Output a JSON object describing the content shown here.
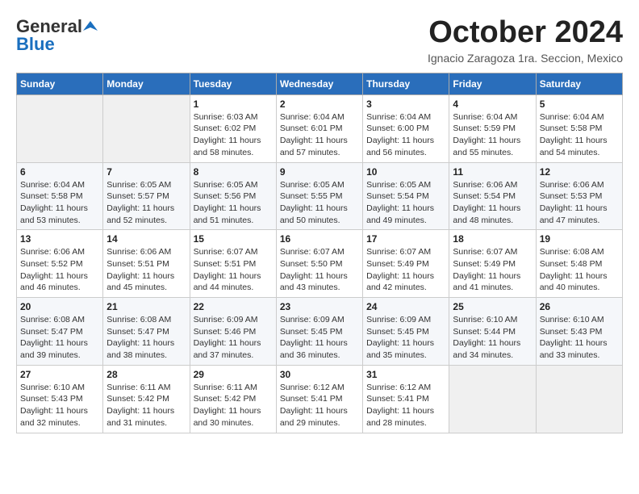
{
  "header": {
    "logo_general": "General",
    "logo_blue": "Blue",
    "month_title": "October 2024",
    "location": "Ignacio Zaragoza 1ra. Seccion, Mexico"
  },
  "days_of_week": [
    "Sunday",
    "Monday",
    "Tuesday",
    "Wednesday",
    "Thursday",
    "Friday",
    "Saturday"
  ],
  "weeks": [
    [
      {
        "day": "",
        "info": ""
      },
      {
        "day": "",
        "info": ""
      },
      {
        "day": "1",
        "info": "Sunrise: 6:03 AM\nSunset: 6:02 PM\nDaylight: 11 hours and 58 minutes."
      },
      {
        "day": "2",
        "info": "Sunrise: 6:04 AM\nSunset: 6:01 PM\nDaylight: 11 hours and 57 minutes."
      },
      {
        "day": "3",
        "info": "Sunrise: 6:04 AM\nSunset: 6:00 PM\nDaylight: 11 hours and 56 minutes."
      },
      {
        "day": "4",
        "info": "Sunrise: 6:04 AM\nSunset: 5:59 PM\nDaylight: 11 hours and 55 minutes."
      },
      {
        "day": "5",
        "info": "Sunrise: 6:04 AM\nSunset: 5:58 PM\nDaylight: 11 hours and 54 minutes."
      }
    ],
    [
      {
        "day": "6",
        "info": "Sunrise: 6:04 AM\nSunset: 5:58 PM\nDaylight: 11 hours and 53 minutes."
      },
      {
        "day": "7",
        "info": "Sunrise: 6:05 AM\nSunset: 5:57 PM\nDaylight: 11 hours and 52 minutes."
      },
      {
        "day": "8",
        "info": "Sunrise: 6:05 AM\nSunset: 5:56 PM\nDaylight: 11 hours and 51 minutes."
      },
      {
        "day": "9",
        "info": "Sunrise: 6:05 AM\nSunset: 5:55 PM\nDaylight: 11 hours and 50 minutes."
      },
      {
        "day": "10",
        "info": "Sunrise: 6:05 AM\nSunset: 5:54 PM\nDaylight: 11 hours and 49 minutes."
      },
      {
        "day": "11",
        "info": "Sunrise: 6:06 AM\nSunset: 5:54 PM\nDaylight: 11 hours and 48 minutes."
      },
      {
        "day": "12",
        "info": "Sunrise: 6:06 AM\nSunset: 5:53 PM\nDaylight: 11 hours and 47 minutes."
      }
    ],
    [
      {
        "day": "13",
        "info": "Sunrise: 6:06 AM\nSunset: 5:52 PM\nDaylight: 11 hours and 46 minutes."
      },
      {
        "day": "14",
        "info": "Sunrise: 6:06 AM\nSunset: 5:51 PM\nDaylight: 11 hours and 45 minutes."
      },
      {
        "day": "15",
        "info": "Sunrise: 6:07 AM\nSunset: 5:51 PM\nDaylight: 11 hours and 44 minutes."
      },
      {
        "day": "16",
        "info": "Sunrise: 6:07 AM\nSunset: 5:50 PM\nDaylight: 11 hours and 43 minutes."
      },
      {
        "day": "17",
        "info": "Sunrise: 6:07 AM\nSunset: 5:49 PM\nDaylight: 11 hours and 42 minutes."
      },
      {
        "day": "18",
        "info": "Sunrise: 6:07 AM\nSunset: 5:49 PM\nDaylight: 11 hours and 41 minutes."
      },
      {
        "day": "19",
        "info": "Sunrise: 6:08 AM\nSunset: 5:48 PM\nDaylight: 11 hours and 40 minutes."
      }
    ],
    [
      {
        "day": "20",
        "info": "Sunrise: 6:08 AM\nSunset: 5:47 PM\nDaylight: 11 hours and 39 minutes."
      },
      {
        "day": "21",
        "info": "Sunrise: 6:08 AM\nSunset: 5:47 PM\nDaylight: 11 hours and 38 minutes."
      },
      {
        "day": "22",
        "info": "Sunrise: 6:09 AM\nSunset: 5:46 PM\nDaylight: 11 hours and 37 minutes."
      },
      {
        "day": "23",
        "info": "Sunrise: 6:09 AM\nSunset: 5:45 PM\nDaylight: 11 hours and 36 minutes."
      },
      {
        "day": "24",
        "info": "Sunrise: 6:09 AM\nSunset: 5:45 PM\nDaylight: 11 hours and 35 minutes."
      },
      {
        "day": "25",
        "info": "Sunrise: 6:10 AM\nSunset: 5:44 PM\nDaylight: 11 hours and 34 minutes."
      },
      {
        "day": "26",
        "info": "Sunrise: 6:10 AM\nSunset: 5:43 PM\nDaylight: 11 hours and 33 minutes."
      }
    ],
    [
      {
        "day": "27",
        "info": "Sunrise: 6:10 AM\nSunset: 5:43 PM\nDaylight: 11 hours and 32 minutes."
      },
      {
        "day": "28",
        "info": "Sunrise: 6:11 AM\nSunset: 5:42 PM\nDaylight: 11 hours and 31 minutes."
      },
      {
        "day": "29",
        "info": "Sunrise: 6:11 AM\nSunset: 5:42 PM\nDaylight: 11 hours and 30 minutes."
      },
      {
        "day": "30",
        "info": "Sunrise: 6:12 AM\nSunset: 5:41 PM\nDaylight: 11 hours and 29 minutes."
      },
      {
        "day": "31",
        "info": "Sunrise: 6:12 AM\nSunset: 5:41 PM\nDaylight: 11 hours and 28 minutes."
      },
      {
        "day": "",
        "info": ""
      },
      {
        "day": "",
        "info": ""
      }
    ]
  ]
}
